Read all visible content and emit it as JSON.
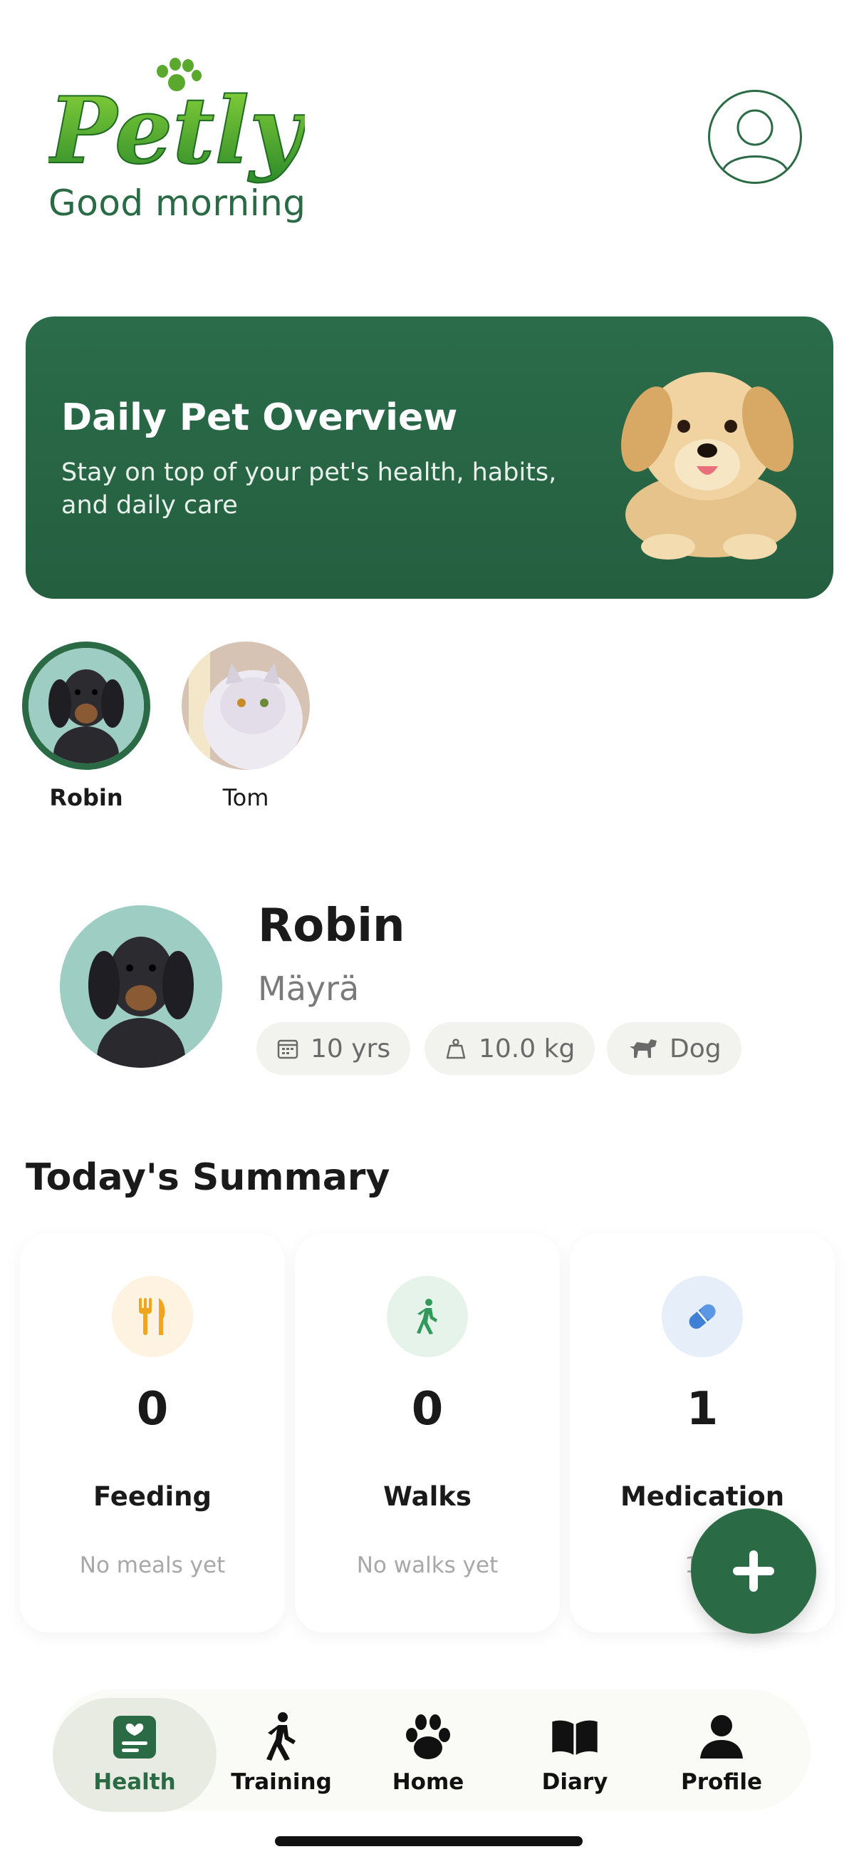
{
  "header": {
    "logo_text": "Petly",
    "greeting": "Good morning"
  },
  "banner": {
    "title": "Daily Pet Overview",
    "subtitle": "Stay on top of your pet's health, habits, and daily care"
  },
  "pets": [
    {
      "name": "Robin",
      "active": true
    },
    {
      "name": "Tom",
      "active": false
    }
  ],
  "profile": {
    "name": "Robin",
    "breed": "Mäyrä",
    "tags": [
      {
        "icon": "calendar-icon",
        "label": "10 yrs"
      },
      {
        "icon": "weight-icon",
        "label": "10.0 kg"
      },
      {
        "icon": "dog-icon",
        "label": "Dog"
      }
    ]
  },
  "summary": {
    "title": "Today's Summary",
    "cards": [
      {
        "icon": "fork-knife-icon",
        "count": "0",
        "label": "Feeding",
        "sub": "No meals yet",
        "icon_bg": "#fdf3e0",
        "icon_color": "#f0a51e"
      },
      {
        "icon": "walking-icon",
        "count": "0",
        "label": "Walks",
        "sub": "No walks yet",
        "icon_bg": "#e6f3ea",
        "icon_color": "#2f9a5a"
      },
      {
        "icon": "pill-icon",
        "count": "1",
        "label": "Medication",
        "sub": "1 g",
        "icon_bg": "#e6eef9",
        "icon_color": "#3f7fd6"
      }
    ]
  },
  "nav": {
    "tabs": [
      {
        "label": "Health",
        "icon": "health-icon",
        "active": true
      },
      {
        "label": "Training",
        "icon": "training-icon",
        "active": false
      },
      {
        "label": "Home",
        "icon": "paw-icon",
        "active": false
      },
      {
        "label": "Diary",
        "icon": "book-icon",
        "active": false
      },
      {
        "label": "Profile",
        "icon": "person-icon",
        "active": false
      }
    ]
  },
  "colors": {
    "brand": "#2a6a44",
    "banner": "#2b6c4a"
  }
}
